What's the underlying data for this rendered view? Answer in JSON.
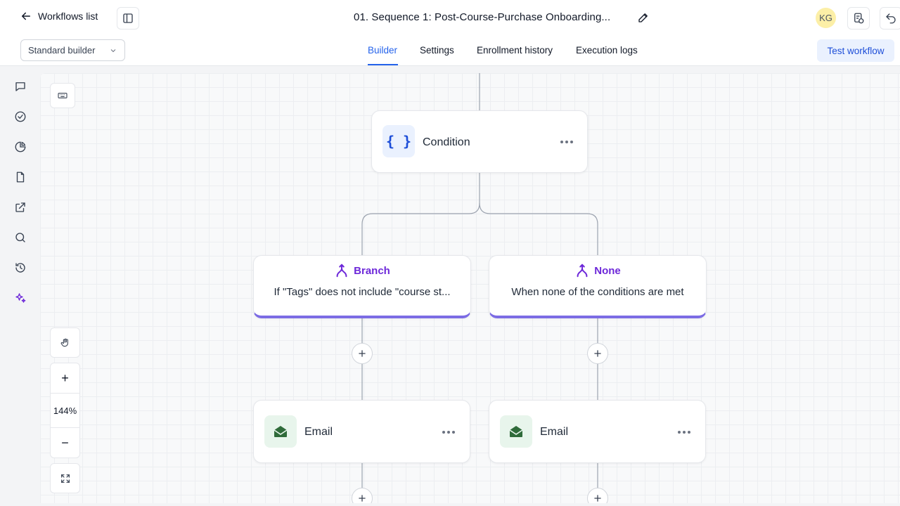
{
  "header": {
    "back_label": "Workflows list",
    "workflow_title": "01. Sequence 1: Post-Course-Purchase Onboarding...",
    "avatar_initials": "KG"
  },
  "subbar": {
    "builder_mode": "Standard builder",
    "tabs": [
      {
        "label": "Builder",
        "active": true
      },
      {
        "label": "Settings",
        "active": false
      },
      {
        "label": "Enrollment history",
        "active": false
      },
      {
        "label": "Execution logs",
        "active": false
      }
    ],
    "test_button": "Test workflow"
  },
  "canvas": {
    "zoom_level": "144%",
    "zoom_in": "+",
    "zoom_out": "−",
    "condition_node": {
      "label": "Condition",
      "icon_glyph": "{ }"
    },
    "branches": [
      {
        "title": "Branch",
        "description": "If \"Tags\" does not include \"course st..."
      },
      {
        "title": "None",
        "description": "When none of the conditions are met"
      }
    ],
    "action_nodes": [
      {
        "label": "Email"
      },
      {
        "label": "Email"
      }
    ]
  },
  "colors": {
    "accent": "#2563eb",
    "branch_accent": "#6d28d9",
    "email_icon": "#2f6b3a"
  }
}
